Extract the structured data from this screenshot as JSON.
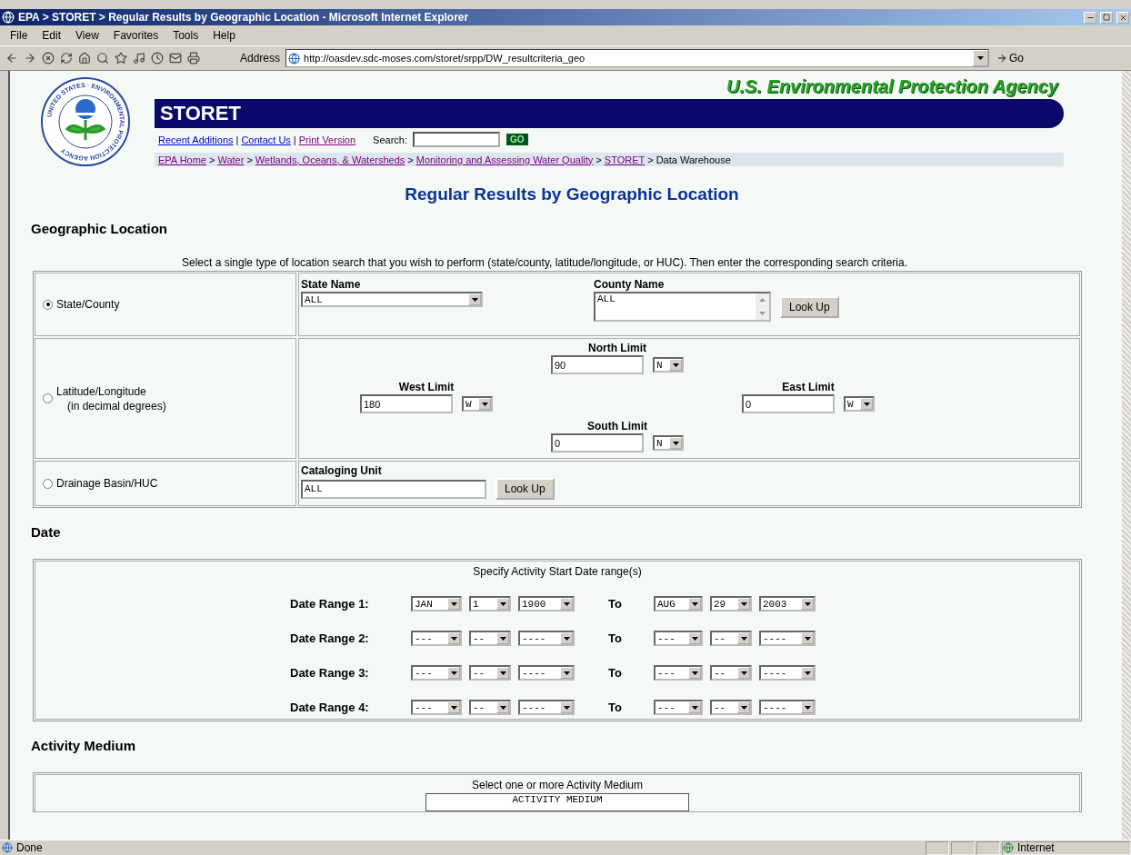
{
  "window": {
    "title": "EPA > STORET > Regular Results by Geographic Location - Microsoft Internet Explorer"
  },
  "menu": [
    "File",
    "Edit",
    "View",
    "Favorites",
    "Tools",
    "Help"
  ],
  "address": {
    "label": "Address",
    "url": "http://oasdev.sdc-moses.com/storet/srpp/DW_resultcriteria_geo",
    "go": "Go"
  },
  "header": {
    "agency": "U.S. Environmental Protection Agency",
    "seal_text": "UNITED STATES · ENVIRONMENTAL PROTECTION AGENCY",
    "site": "STORET",
    "links": [
      {
        "label": "Recent Additions",
        "visited": false
      },
      {
        "separator": "|",
        "label": "Contact Us",
        "visited": false
      },
      {
        "separator": "|",
        "label": "Print Version",
        "visited": true
      }
    ],
    "search": {
      "label": "Search:",
      "button": "GO"
    },
    "breadcrumb": [
      {
        "label": "EPA Home",
        "link": true
      },
      {
        "separator": ">",
        "label": "Water",
        "link": true
      },
      {
        "separator": ">",
        "label": "Wetlands, Oceans, & Watersheds",
        "link": true
      },
      {
        "separator": ">",
        "label": "Monitoring and Assessing Water Quality",
        "link": true
      },
      {
        "separator": ">",
        "label": "STORET",
        "link": true
      },
      {
        "separator": ">",
        "label": "Data Warehouse",
        "link": false
      }
    ]
  },
  "heading": "Regular Results by Geographic Location",
  "geographic": {
    "title": "Geographic Location",
    "instructions": "Select a single type of location search that you wish to perform (state/county, latitude/longitude, or HUC). Then enter the corresponding search criteria.",
    "options": [
      {
        "kind": "state_county",
        "label": "State/County",
        "selected": true,
        "state_label": "State Name",
        "state_value": "ALL",
        "county_label": "County Name",
        "county_value": "ALL",
        "button": "Look Up"
      },
      {
        "kind": "lat_long",
        "label": "Latitude/Longitude",
        "sublabel": "(in decimal degrees)",
        "selected": false,
        "limits": [
          {
            "label": "North Limit",
            "value": "90",
            "dir": "N"
          },
          {
            "label": "West Limit",
            "value": "180",
            "dir": "W"
          },
          {
            "label": "East Limit",
            "value": "0",
            "dir": "W"
          },
          {
            "label": "South Limit",
            "value": "0",
            "dir": "N"
          }
        ]
      },
      {
        "kind": "huc",
        "label": "Drainage Basin/HUC",
        "selected": false,
        "field_label": "Cataloging Unit",
        "value": "ALL",
        "button": "Look Up"
      }
    ]
  },
  "date": {
    "title": "Date",
    "caption": "Specify Activity Start Date range(s)",
    "ranges": [
      {
        "label": "Date Range 1:",
        "from": [
          "JAN",
          "1",
          "1900"
        ],
        "to_label": "To",
        "to": [
          "AUG",
          "29",
          "2003"
        ]
      },
      {
        "label": "Date Range 2:",
        "from": [
          "---",
          "--",
          "----"
        ],
        "to_label": "To",
        "to": [
          "---",
          "--",
          "----"
        ]
      },
      {
        "label": "Date Range 3:",
        "from": [
          "---",
          "--",
          "----"
        ],
        "to_label": "To",
        "to": [
          "---",
          "--",
          "----"
        ]
      },
      {
        "label": "Date Range 4:",
        "from": [
          "---",
          "--",
          "----"
        ],
        "to_label": "To",
        "to": [
          "---",
          "--",
          "----"
        ]
      }
    ]
  },
  "medium": {
    "title": "Activity Medium",
    "caption": "Select one or more Activity Medium",
    "list_header": "ACTIVITY MEDIUM"
  },
  "status_bar": {
    "text": "Done",
    "zone": "Internet"
  }
}
